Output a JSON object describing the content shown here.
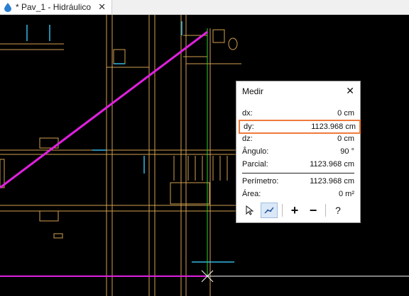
{
  "tab": {
    "title": "* Pav_1 - Hidráulico",
    "close": "✕",
    "icon": "water-drop-icon"
  },
  "panel": {
    "title": "Medir",
    "close": "✕",
    "rows": [
      {
        "label": "dx:",
        "value": "0 cm"
      },
      {
        "label": "dy:",
        "value": "1123.968 cm"
      },
      {
        "label": "dz:",
        "value": "0 cm"
      },
      {
        "label": "Ângulo:",
        "value": "90 °"
      },
      {
        "label": "Parcial:",
        "value": "1123.968 cm"
      },
      {
        "label": "Perímetro:",
        "value": "1123.968 cm"
      },
      {
        "label": "Área:",
        "value": "0 m²"
      }
    ],
    "tools": {
      "select": "select-arrow-icon",
      "polyline": "polyline-icon",
      "add": "+",
      "remove": "−",
      "help": "?"
    }
  },
  "colors": {
    "background": "#000000",
    "walls": "#d2a14f",
    "measure_line": "#e020e0",
    "crosshair": "#ffffff",
    "axis_green": "#2bd12b",
    "highlight": "#f07a3a",
    "pipes": "#34b8e6"
  }
}
